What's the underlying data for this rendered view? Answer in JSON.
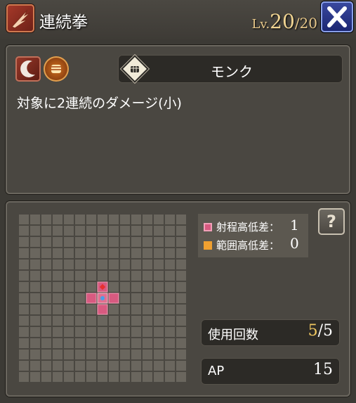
{
  "header": {
    "title": "連続拳",
    "level_label": "Lv.",
    "level_current": "20",
    "level_max": "/20",
    "skill_icon": "claw-slash-icon",
    "close_icon": "close-x-icon"
  },
  "info": {
    "type_icons": [
      "crescent-slash-icon",
      "fist-burst-icon"
    ],
    "job_icon": "fist-icon",
    "job_name": "モンク",
    "description": "対象に2連続のダメージ(小)"
  },
  "range": {
    "legend": [
      {
        "label": "射程高低差：",
        "value": "1",
        "color": "#d85a80"
      },
      {
        "label": "範囲高低差：",
        "value": "0",
        "color": "#f0a030"
      }
    ],
    "help_icon": "question-book-icon",
    "grid_size": 15,
    "cells": {
      "target": [
        [
          7,
          7
        ]
      ],
      "area": [
        [
          6,
          7
        ],
        [
          7,
          6
        ],
        [
          7,
          8
        ],
        [
          8,
          7
        ]
      ]
    }
  },
  "stats": {
    "uses_label": "使用回数",
    "uses_current": "5",
    "uses_max": "/5",
    "ap_label": "AP",
    "ap_value": "15"
  },
  "colors": {
    "area_cell": "#d85a80",
    "target_cell": "#4aa0e8",
    "close_button": "#2a3488"
  }
}
